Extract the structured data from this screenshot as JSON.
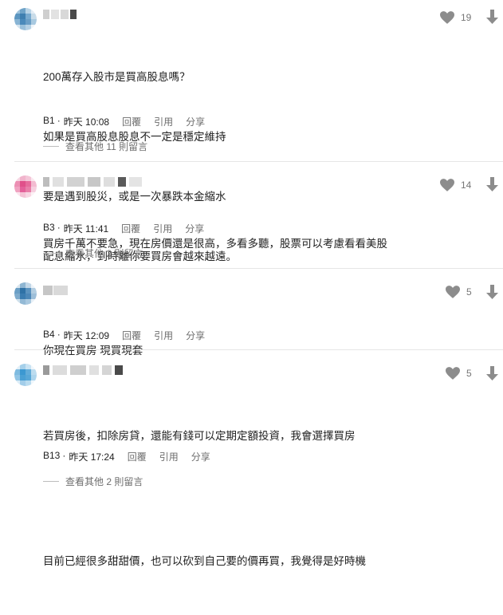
{
  "comments": [
    {
      "likes": "19",
      "lines": [
        "200萬存入股市是買高股息嗎？",
        "如果是買高股息股息不一定是穩定維持",
        "要是遇到股災，或是一次暴跌本金縮水",
        "配息縮水，到時離你要買房會越來越遠。"
      ],
      "floor": "B1",
      "time": "昨天 10:08",
      "reply": "回覆",
      "quote": "引用",
      "share": "分享",
      "more_replies": "查看其他 11 則留言"
    },
    {
      "likes": "14",
      "lines": [
        "買房千萬不要急，現在房價還是很高，多看多聽，股票可以考慮看看美股"
      ],
      "floor": "B3",
      "time": "昨天 11:41",
      "reply": "回覆",
      "quote": "引用",
      "share": "分享",
      "more_replies": "查看其他 2 則留言"
    },
    {
      "likes": "5",
      "lines": [
        "你現在買房 現買現套"
      ],
      "floor": "B4",
      "time": "昨天 12:09",
      "reply": "回覆",
      "quote": "引用",
      "share": "分享"
    },
    {
      "likes": "5",
      "lines": [
        "若買房後，扣除房貸，還能有錢可以定期定額投資，我會選擇買房",
        "",
        "目前已經很多甜甜價，也可以砍到自己要的價再買，我覺得是好時機"
      ],
      "floor": "B13",
      "time": "昨天 17:24",
      "reply": "回覆",
      "quote": "引用",
      "share": "分享",
      "more_replies": "查看其他 2 則留言"
    }
  ],
  "colors": {
    "heart": "#8c8c8c",
    "divider": "#e6e6e6",
    "avatar_blue": "#4a90c2",
    "avatar_pink": "#e04f8a"
  },
  "icons": {
    "like": "heart-icon",
    "dislike": "down-arrow-icon"
  }
}
